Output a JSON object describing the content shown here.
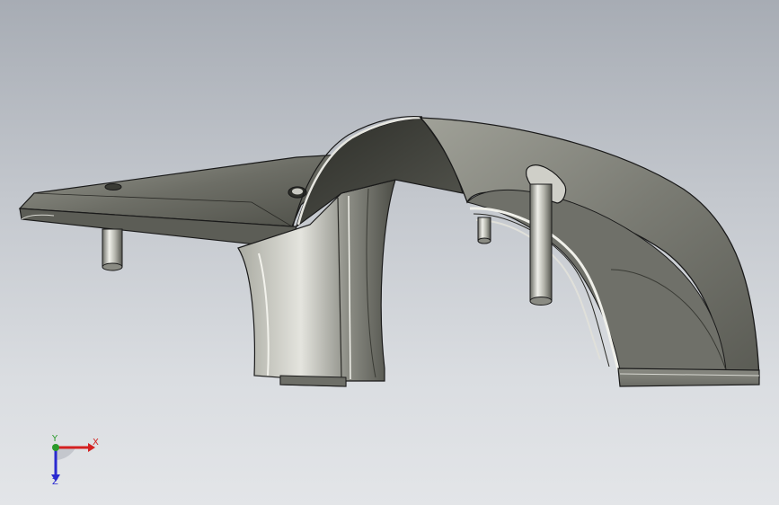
{
  "viewport": {
    "background_top": "#a7acb4",
    "background_bottom": "#e3e5e8"
  },
  "model": {
    "part": "fender-bracket",
    "edge_color": "#1a1a1a",
    "shade_dark": "#4a4b45",
    "shade_mid": "#75766e",
    "shade_light": "#b8b9b0",
    "highlight": "#e8e8e2"
  },
  "triad": {
    "x_label": "X",
    "y_label": "Y",
    "z_label": "Z",
    "x_color": "#d42020",
    "y_color": "#2a9a2a",
    "z_color": "#2a2ad0"
  }
}
